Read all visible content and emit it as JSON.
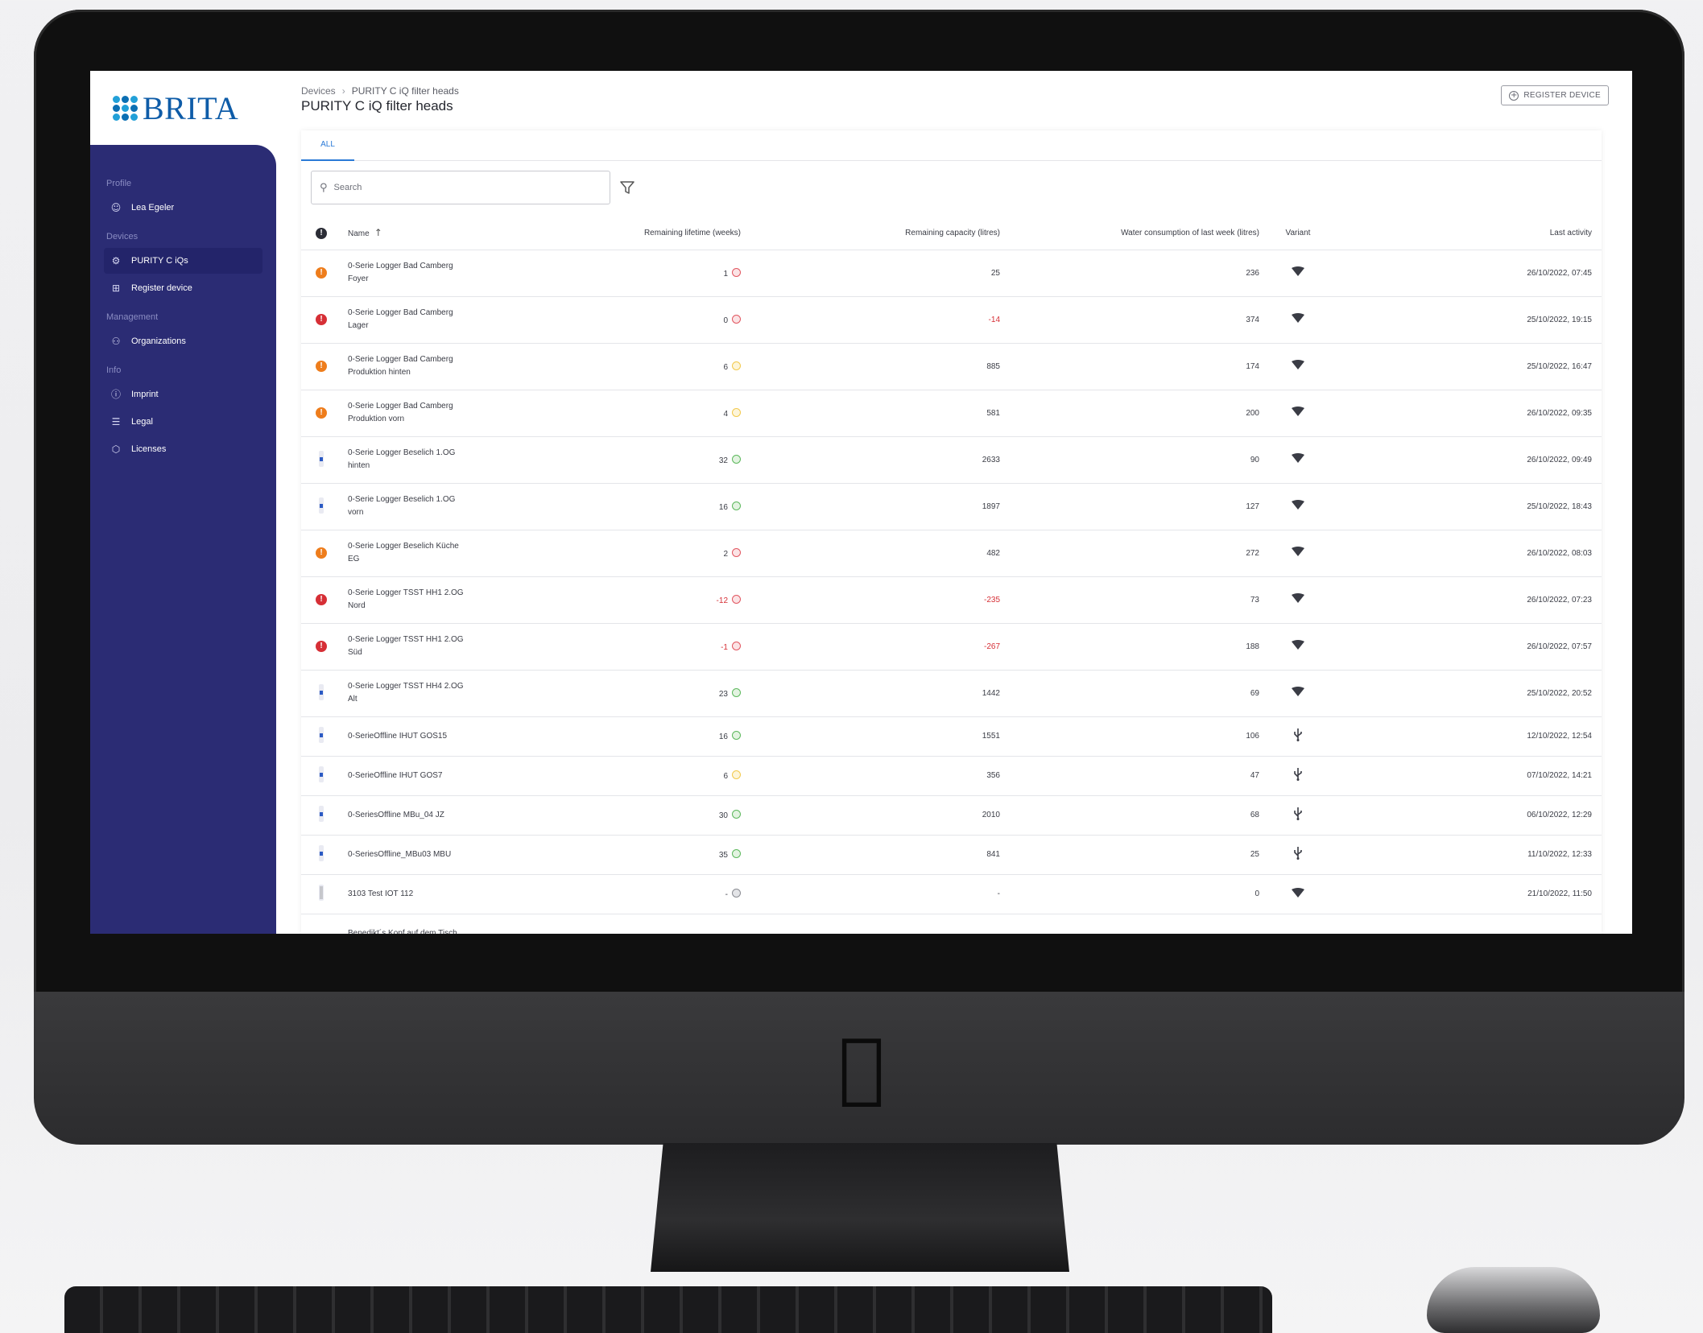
{
  "brand": {
    "logo_text": "BRITA",
    "color": "#0e5ca8",
    "dot_colors": [
      "#22a0d8",
      "#0b6fb3"
    ]
  },
  "sidebar": {
    "background": "#2b2c74",
    "sections": [
      {
        "title": "Profile",
        "items": [
          {
            "label": "Lea Egeler",
            "icon": "user-icon"
          }
        ]
      },
      {
        "title": "Devices",
        "items": [
          {
            "label": "PURITY C iQs",
            "icon": "gear-icon",
            "active": true
          },
          {
            "label": "Register device",
            "icon": "add-box-icon"
          }
        ]
      },
      {
        "title": "Management",
        "items": [
          {
            "label": "Organizations",
            "icon": "users-icon"
          }
        ]
      },
      {
        "title": "Info",
        "items": [
          {
            "label": "Imprint",
            "icon": "info-icon"
          },
          {
            "label": "Legal",
            "icon": "document-icon"
          },
          {
            "label": "Licenses",
            "icon": "package-icon"
          }
        ]
      }
    ]
  },
  "header": {
    "breadcrumb": [
      "Devices",
      "PURITY C iQ filter heads"
    ],
    "title": "PURITY C iQ filter heads",
    "register_button": "REGISTER DEVICE"
  },
  "tabs": [
    {
      "label": "ALL",
      "active": true
    }
  ],
  "search": {
    "placeholder": "Search",
    "value": ""
  },
  "table": {
    "columns": [
      "Name",
      "Remaining lifetime (weeks)",
      "Remaining capacity (litres)",
      "Water consumption of last week (litres)",
      "Variant",
      "Last activity"
    ],
    "sort": {
      "column": "Name",
      "direction": "ascending"
    },
    "rows": [
      {
        "status": "warning",
        "name": [
          "0-Serie Logger Bad Camberg",
          "Foyer"
        ],
        "lifetime": "1",
        "indicator": "red",
        "capacity": "25",
        "water": "236",
        "variant": "wifi",
        "last": "26/10/2022, 07:45"
      },
      {
        "status": "error",
        "name": [
          "0-Serie Logger Bad Camberg",
          "Lager"
        ],
        "lifetime": "0",
        "indicator": "red",
        "capacity": "-14",
        "water": "374",
        "variant": "wifi",
        "last": "25/10/2022, 19:15"
      },
      {
        "status": "warning",
        "name": [
          "0-Serie Logger Bad Camberg",
          "Produktion hinten"
        ],
        "lifetime": "6",
        "indicator": "yellow",
        "capacity": "885",
        "water": "174",
        "variant": "wifi",
        "last": "25/10/2022, 16:47"
      },
      {
        "status": "warning",
        "name": [
          "0-Serie Logger Bad Camberg",
          "Produktion vorn"
        ],
        "lifetime": "4",
        "indicator": "yellow",
        "capacity": "581",
        "water": "200",
        "variant": "wifi",
        "last": "26/10/2022, 09:35"
      },
      {
        "status": "ok",
        "name": [
          "0-Serie Logger Beselich 1.OG",
          "hinten"
        ],
        "lifetime": "32",
        "indicator": "green",
        "capacity": "2633",
        "water": "90",
        "variant": "wifi",
        "last": "26/10/2022, 09:49"
      },
      {
        "status": "ok",
        "name": [
          "0-Serie Logger Beselich 1.OG",
          "vorn"
        ],
        "lifetime": "16",
        "indicator": "green",
        "capacity": "1897",
        "water": "127",
        "variant": "wifi",
        "last": "25/10/2022, 18:43"
      },
      {
        "status": "warning",
        "name": [
          "0-Serie Logger Beselich Küche",
          "EG"
        ],
        "lifetime": "2",
        "indicator": "red",
        "capacity": "482",
        "water": "272",
        "variant": "wifi",
        "last": "26/10/2022, 08:03"
      },
      {
        "status": "error",
        "name": [
          "0-Serie Logger TSST HH1 2.OG",
          "Nord"
        ],
        "lifetime": "-12",
        "indicator": "red",
        "capacity": "-235",
        "water": "73",
        "variant": "wifi",
        "last": "26/10/2022, 07:23"
      },
      {
        "status": "error",
        "name": [
          "0-Serie Logger TSST HH1 2.OG",
          "Süd"
        ],
        "lifetime": "-1",
        "indicator": "red",
        "capacity": "-267",
        "water": "188",
        "variant": "wifi",
        "last": "26/10/2022, 07:57"
      },
      {
        "status": "ok",
        "name": [
          "0-Serie Logger TSST HH4 2.OG",
          "Alt"
        ],
        "lifetime": "23",
        "indicator": "green",
        "capacity": "1442",
        "water": "69",
        "variant": "wifi",
        "last": "25/10/2022, 20:52"
      },
      {
        "status": "ok",
        "name": [
          "0-SerieOffline IHUT GOS15"
        ],
        "lifetime": "16",
        "indicator": "green",
        "capacity": "1551",
        "water": "106",
        "variant": "usb",
        "last": "12/10/2022, 12:54"
      },
      {
        "status": "ok",
        "name": [
          "0-SerieOffline IHUT GOS7"
        ],
        "lifetime": "6",
        "indicator": "yellow",
        "capacity": "356",
        "water": "47",
        "variant": "usb",
        "last": "07/10/2022, 14:21"
      },
      {
        "status": "ok",
        "name": [
          "0-SeriesOffline MBu_04 JZ"
        ],
        "lifetime": "30",
        "indicator": "green",
        "capacity": "2010",
        "water": "68",
        "variant": "usb",
        "last": "06/10/2022, 12:29"
      },
      {
        "status": "ok",
        "name": [
          "0-SeriesOffline_MBu03 MBU"
        ],
        "lifetime": "35",
        "indicator": "green",
        "capacity": "841",
        "water": "25",
        "variant": "usb",
        "last": "11/10/2022, 12:33"
      },
      {
        "status": "empty",
        "name": [
          "3103 Test IOT 112"
        ],
        "lifetime": "-",
        "indicator": "grey",
        "capacity": "-",
        "water": "0",
        "variant": "wifi",
        "last": "21/10/2022, 11:50"
      },
      {
        "status": "none",
        "name": [
          "Benedikt´s Kopf auf dem Tisch"
        ],
        "lifetime": "",
        "indicator": "",
        "capacity": "",
        "water": "",
        "variant": "",
        "last": ""
      }
    ]
  }
}
